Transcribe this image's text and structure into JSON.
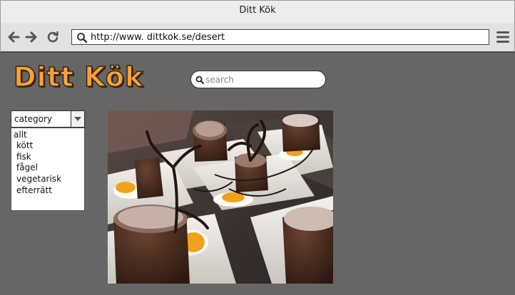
{
  "window": {
    "title": "Ditt Kök"
  },
  "browser": {
    "url": "http://www. dittkok.se/desert",
    "icons": {
      "back": "arrow-left-icon",
      "forward": "arrow-right-icon",
      "reload": "reload-icon",
      "url_search": "search-icon",
      "menu": "hamburger-menu-icon"
    }
  },
  "site": {
    "logo": "Ditt Kök",
    "search": {
      "placeholder": "search",
      "value": ""
    },
    "category": {
      "selected": "category",
      "options": [
        "allt",
        "kött",
        "fisk",
        "fågel",
        "vegetarisk",
        "efterrätt"
      ]
    }
  },
  "colors": {
    "background": "#666666",
    "logo": "#f6a13a",
    "logo_outline": "#3a2510"
  }
}
